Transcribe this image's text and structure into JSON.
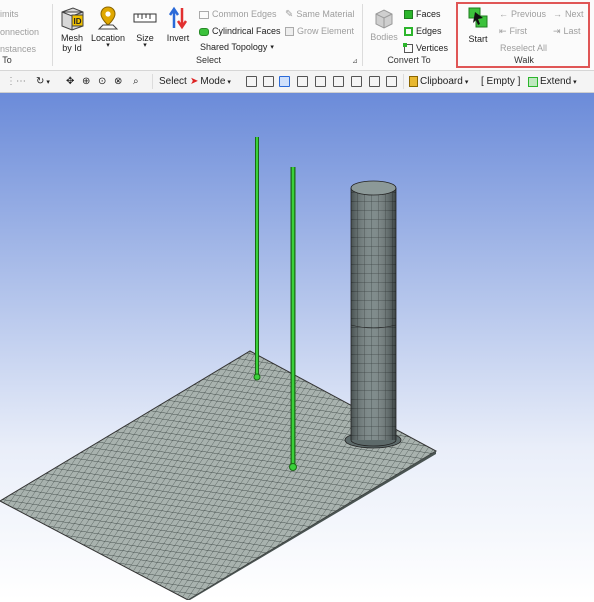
{
  "ribbon": {
    "partial_left": {
      "limits": "imits",
      "connection": "onnection",
      "instances": "nstances",
      "group_label": "To"
    },
    "select_group": {
      "mesh_by_id": "Mesh\nby Id",
      "location": "Location",
      "size": "Size",
      "invert": "Invert",
      "common_edges": "Common Edges",
      "cylindrical_faces": "Cylindrical Faces",
      "shared_topology": "Shared Topology",
      "same_material": "Same Material",
      "grow_element": "Grow Element",
      "group_label": "Select"
    },
    "convert_group": {
      "bodies": "Bodies",
      "faces": "Faces",
      "edges": "Edges",
      "vertices": "Vertices",
      "group_label": "Convert To"
    },
    "walk_group": {
      "start": "Start",
      "previous": "Previous",
      "next": "Next",
      "first": "First",
      "last": "Last",
      "reselect_all": "Reselect All",
      "group_label": "Walk"
    }
  },
  "toolbar": {
    "select": "Select",
    "mode": "Mode",
    "clipboard": "Clipboard",
    "empty": "[ Empty ]",
    "extend": "Extend"
  },
  "colors": {
    "highlight": "#e05656",
    "green": "#2cb52c",
    "mesh": "#3d4a4a"
  }
}
